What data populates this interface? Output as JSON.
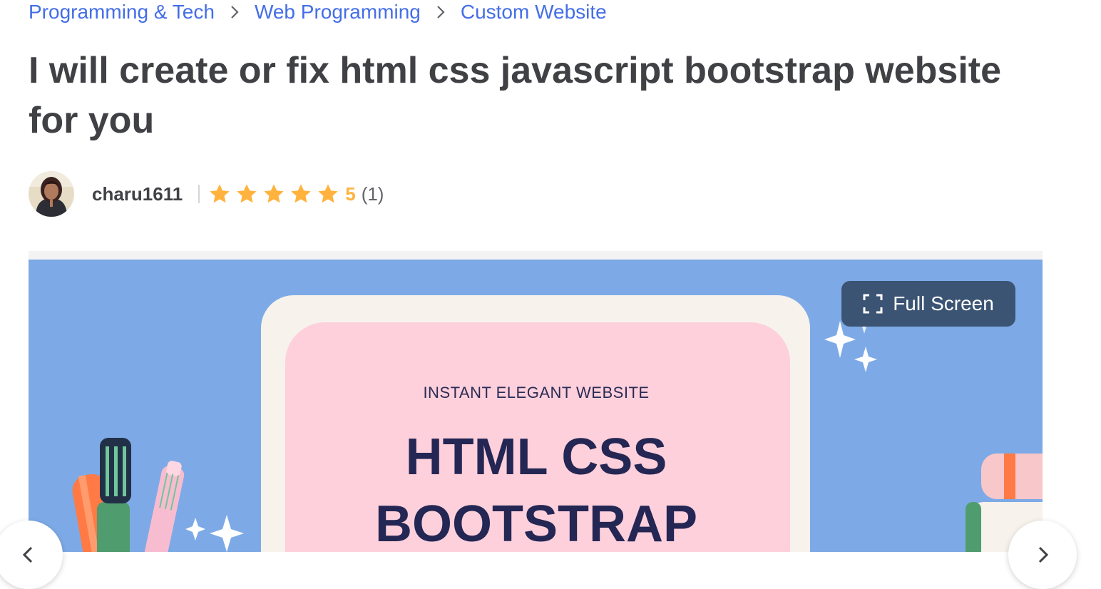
{
  "breadcrumb": {
    "items": [
      "Programming & Tech",
      "Web Programming",
      "Custom Website"
    ]
  },
  "gig": {
    "title": "I will create or fix html css javascript bootstrap website for you"
  },
  "seller": {
    "username": "charu1611",
    "rating": {
      "stars": 5,
      "score": "5",
      "count": "(1)"
    }
  },
  "gallery": {
    "fullscreen_label": "Full Screen",
    "slide": {
      "subtitle": "INSTANT ELEGANT WEBSITE",
      "heading_line1": "HTML CSS",
      "heading_line2": "BOOTSTRAP"
    }
  },
  "icons": {
    "breadcrumb_separator": "chevron-right-icon",
    "rating": "star-icon",
    "fullscreen": "fullscreen-icon",
    "prev": "chevron-left-icon",
    "next": "chevron-right-icon"
  },
  "colors": {
    "link": "#446ee7",
    "text": "#404145",
    "star": "#ffb33e",
    "gallery_bg": "#7daae6",
    "fullscreen_button": "#3c5473",
    "slide_heading": "#242653"
  }
}
